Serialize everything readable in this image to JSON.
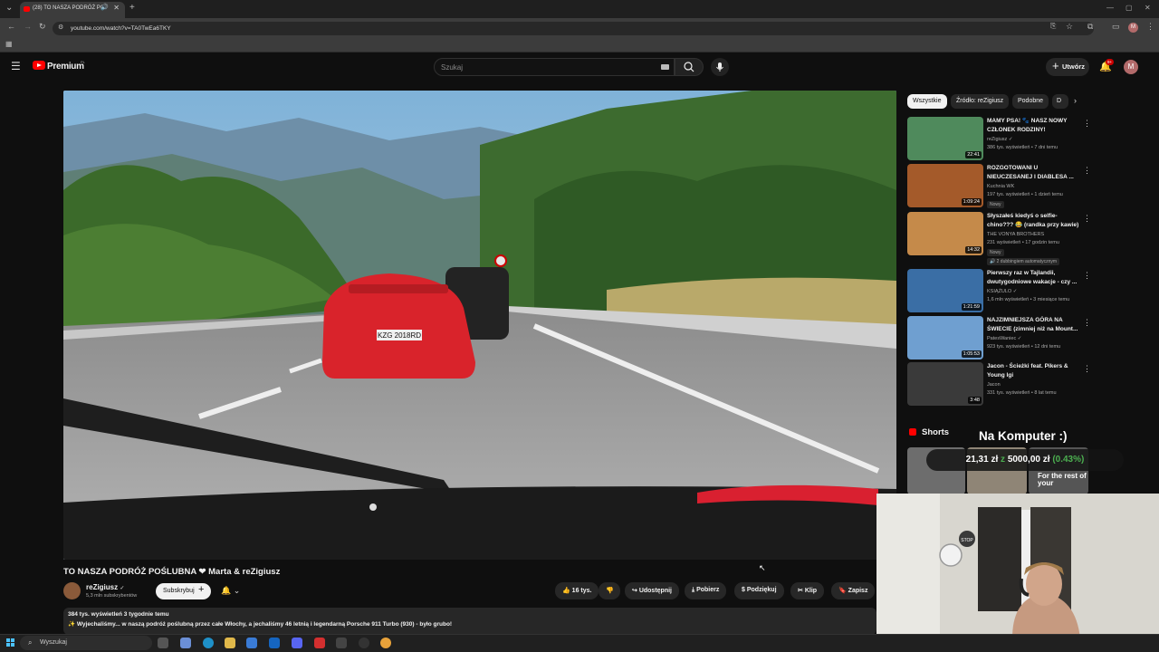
{
  "browser": {
    "tab_title": "(28) TO NASZA PODRÓŻ PO",
    "url": "youtube.com/watch?v=TA0TwEa6TKY"
  },
  "header": {
    "logo_text": "Premium",
    "logo_sup": "PL",
    "search_placeholder": "Szukaj",
    "create_label": "Utwórz",
    "notifications_count": "9+",
    "avatar_letter": "M"
  },
  "chips": [
    "Wszystkie",
    "Źródło: reZigiusz",
    "Podobne",
    "D"
  ],
  "recommendations": [
    {
      "title": "MAMY PSA! 🐾 NASZ NOWY CZŁONEK RODZINY!",
      "channel": "reZigiusz ✓",
      "meta": "386 tys. wyświetleń • 7 dni temu",
      "badge": "",
      "extra": "",
      "duration": "22:41",
      "color": "#4f8a5c"
    },
    {
      "title": "ROZGOTOWANI U NIEUCZESANEJ I DIABLESA ...",
      "channel": "Kuchnia WK",
      "meta": "197 tys. wyświetleń • 1 dzień temu",
      "badge": "Nowy",
      "extra": "",
      "duration": "1:09:24",
      "color": "#a45a2a"
    },
    {
      "title": "Słyszałeś kiedyś o selfie-chino??? 😂 (randka przy kawie)",
      "channel": "THE VONYA BROTHERS",
      "meta": "231 wyświetleń • 17 godzin temu",
      "badge": "Nowy",
      "extra": "🔊 2 dubbingiem automatycznym",
      "duration": "14:32",
      "color": "#c58a4a"
    },
    {
      "title": "Pierwszy raz w Tajlandii, dwutygodniowe wakacje - czy ...",
      "channel": "KSIĄŻULO ✓",
      "meta": "1,6 mln wyświetleń • 3 miesiące temu",
      "badge": "",
      "extra": "",
      "duration": "1:21:59",
      "color": "#3a6ea5"
    },
    {
      "title": "NAJZIMNIEJSZA GÓRA NA ŚWIECIE (zimniej niż na Mount...",
      "channel": "PatesWaniec ✓",
      "meta": "923 tys. wyświetleń • 12 dni temu",
      "badge": "",
      "extra": "",
      "duration": "1:05:53",
      "color": "#6f9fd0"
    },
    {
      "title": "Jacon - Ścieżki feat. Pikers & Young Igi",
      "channel": "Jacon",
      "meta": "331 tys. wyświetleń • 8 lat temu",
      "badge": "",
      "extra": "",
      "duration": "3:48",
      "color": "#3a3a3a"
    }
  ],
  "shorts": {
    "heading": "Shorts",
    "thumb_text": "For the rest of your"
  },
  "stream_overlay": {
    "title": "Na Komputer :)",
    "amount": "21,31 zł",
    "separator": "z",
    "goal": "5000,00 zł",
    "percent": "(0.43%)"
  },
  "webcam": {
    "sign_text": "STOP"
  },
  "video": {
    "title": "TO NASZA PODRÓŻ POŚLUBNA ❤ Marta & reZigiusz",
    "plate": "KZG 2018RD",
    "channel": "reZigiusz",
    "verified": "✓",
    "subscribers": "5,3 mln subskrybentów",
    "subscribe_label": "Subskrybuj",
    "likes": "16 tys.",
    "share_label": "Udostępnij",
    "download_label": "Pobierz",
    "thanks_label": "Podziękuj",
    "clip_label": "Klip",
    "save_label": "Zapisz",
    "views_meta": "384 tys. wyświetleń  3 tygodnie temu",
    "description": "✨ Wyjechaliśmy... w naszą podróż poślubną przez całe Włochy, a jechaliśmy 46 letnią i legendarną Porsche 911 Turbo (930) - było grubo!"
  },
  "taskbar": {
    "search_label": "Wyszukaj"
  }
}
